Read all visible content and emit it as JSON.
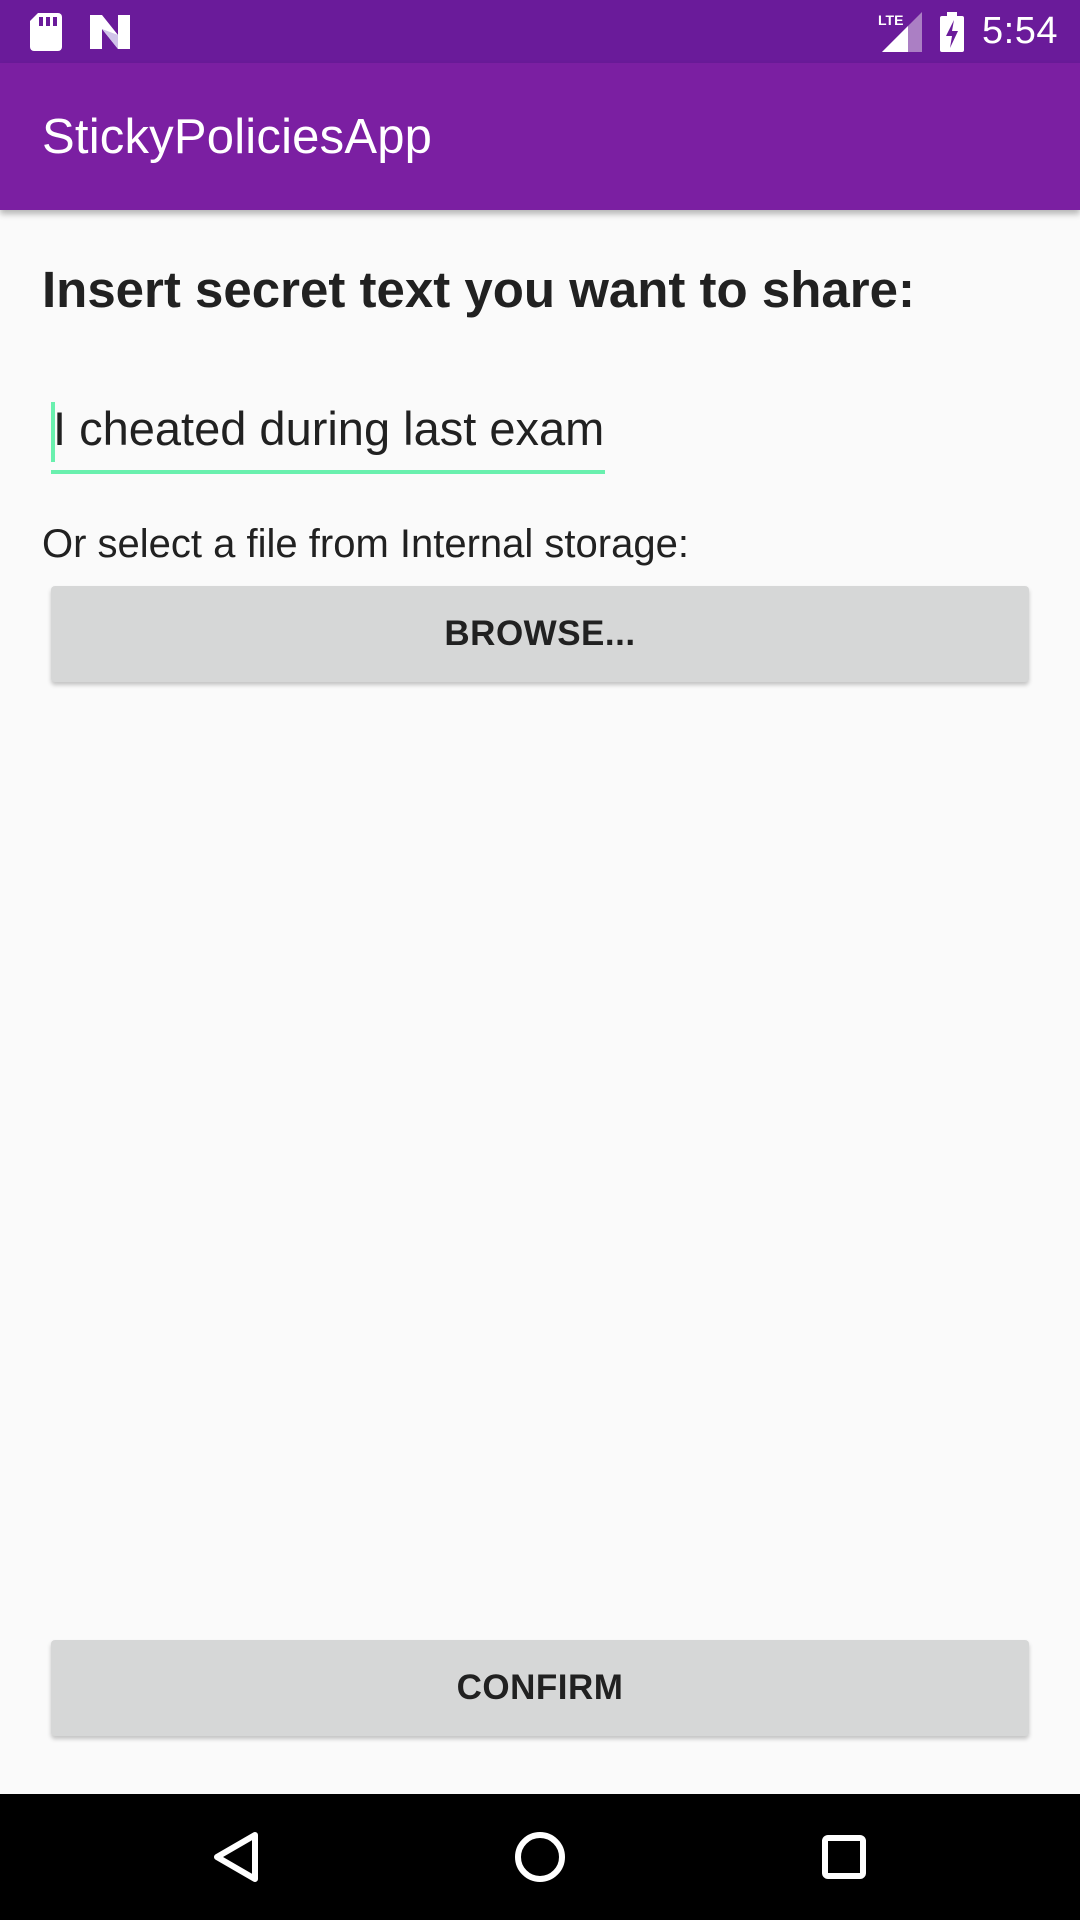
{
  "status_bar": {
    "time": "5:54",
    "network_label": "LTE",
    "icons": [
      "sd-card-icon",
      "n-logo-icon",
      "signal-icon",
      "battery-charging-icon"
    ]
  },
  "app_bar": {
    "title": "StickyPoliciesApp"
  },
  "main": {
    "heading": "Insert secret text you want to share:",
    "secret_input_value": "I cheated during last exam",
    "file_label": "Or select a file from Internal storage:",
    "browse_label": "BROWSE...",
    "confirm_label": "CONFIRM"
  },
  "nav_bar": {
    "icons": [
      "back-icon",
      "home-icon",
      "recents-icon"
    ]
  },
  "colors": {
    "status_bar": "#6a1b9a",
    "app_bar": "#7b1fa2",
    "accent": "#69f0ae",
    "button": "#d6d7d7",
    "background": "#fafafa"
  }
}
